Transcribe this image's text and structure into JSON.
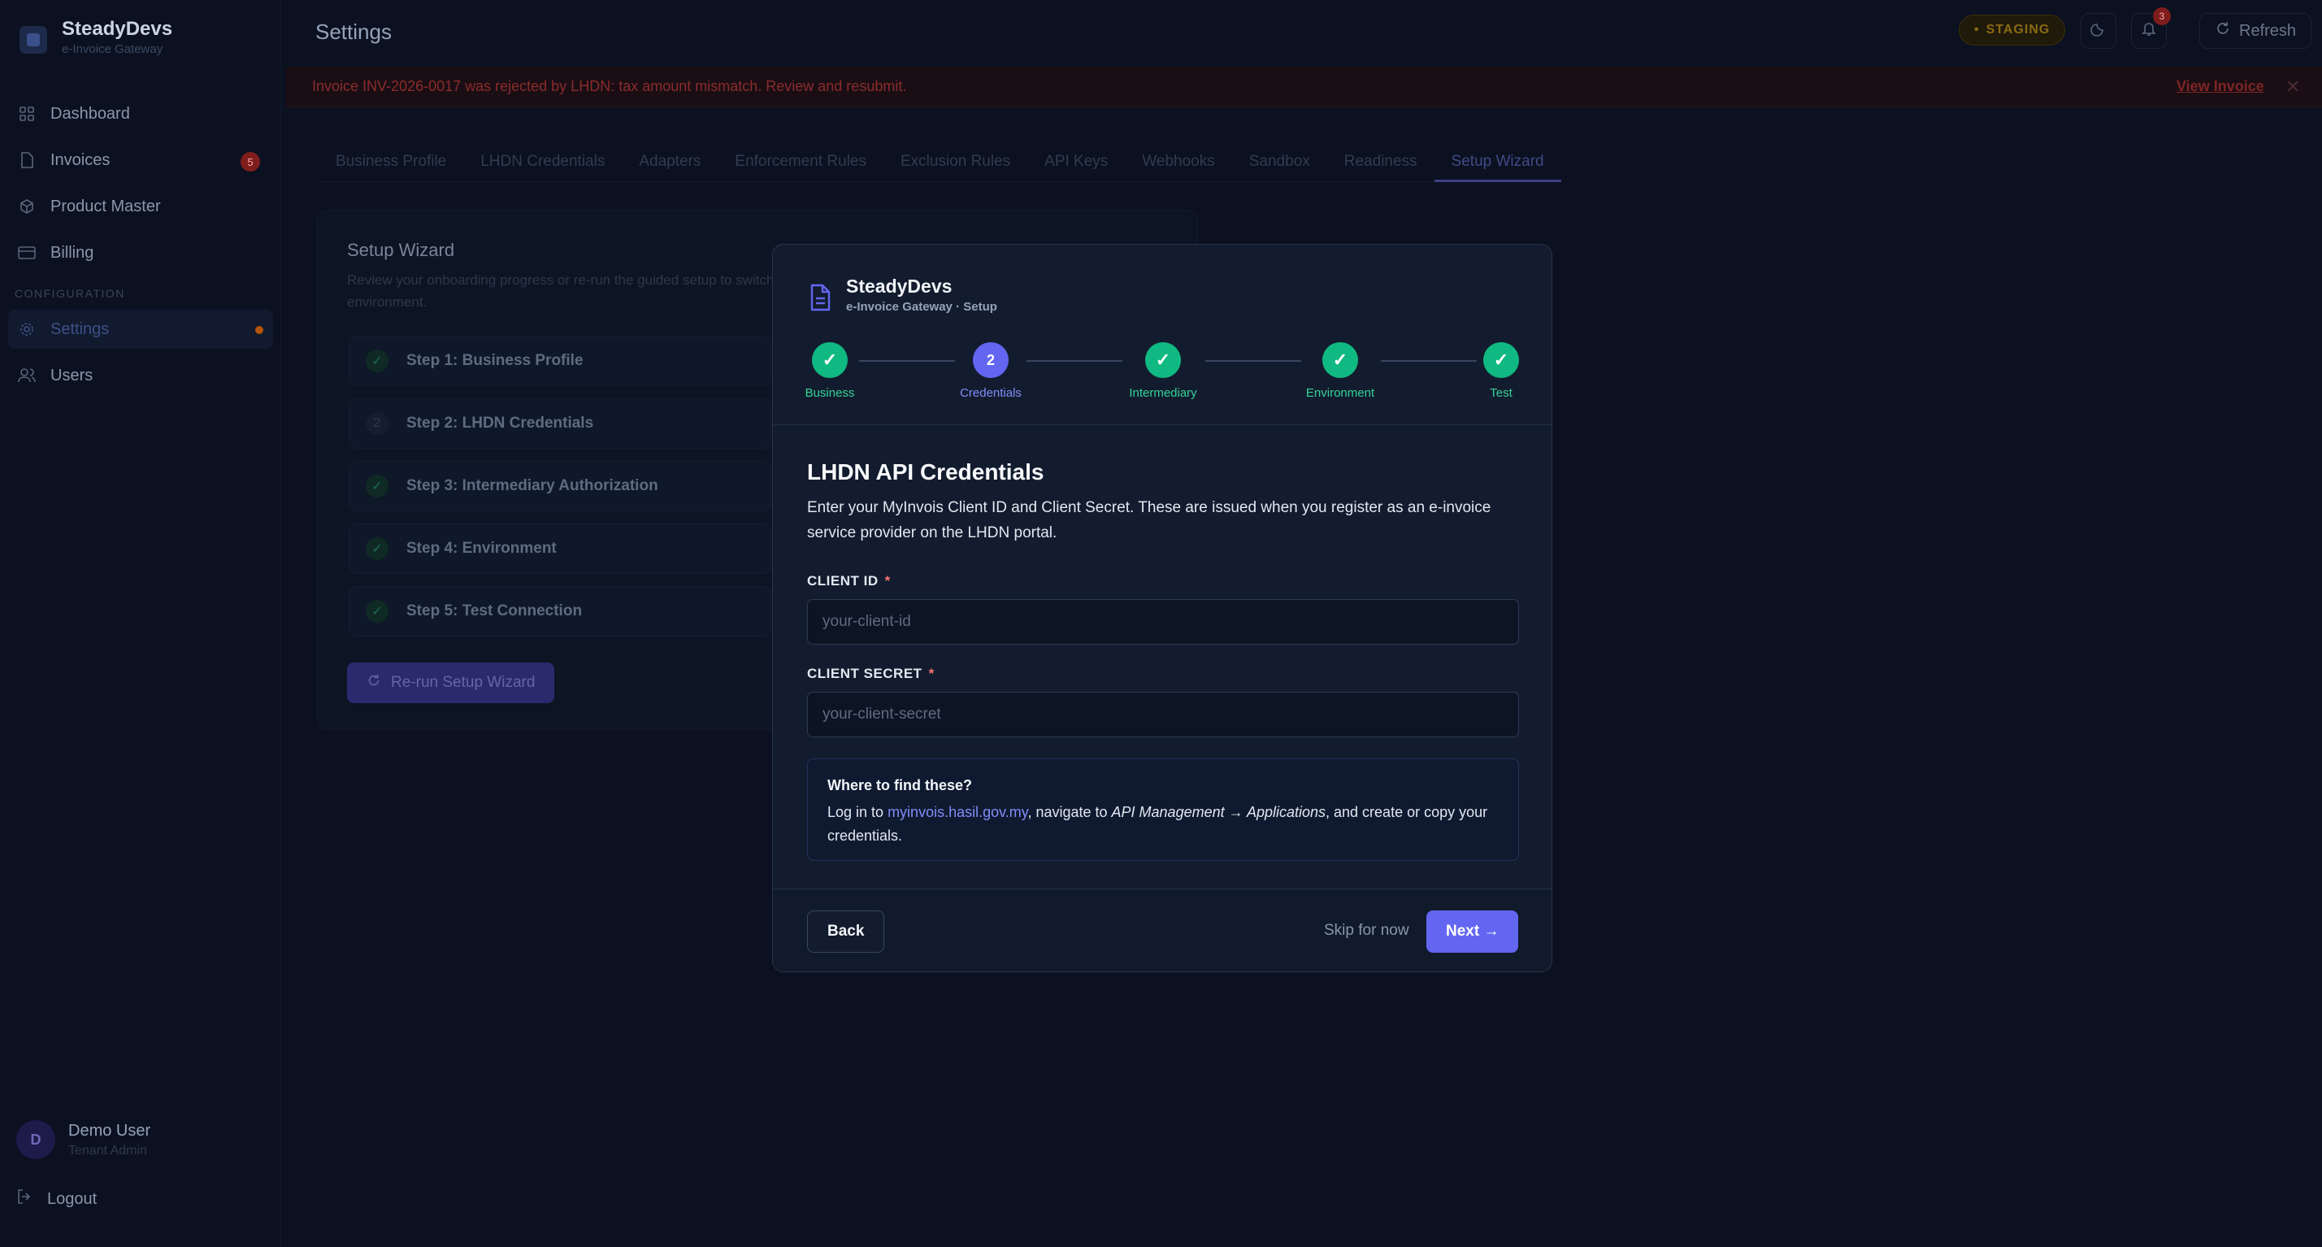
{
  "app": {
    "name": "SteadyDevs",
    "subtitle": "e-Invoice Gateway"
  },
  "sidebar": {
    "items": [
      {
        "label": "Dashboard",
        "icon": "grid-icon"
      },
      {
        "label": "Invoices",
        "icon": "file-icon",
        "badge": "5"
      },
      {
        "label": "Product Master",
        "icon": "package-icon"
      },
      {
        "label": "Billing",
        "icon": "credit-card-icon"
      }
    ],
    "section_label": "CONFIGURATION",
    "config_items": [
      {
        "label": "Settings",
        "icon": "gear-icon",
        "active": true
      },
      {
        "label": "Users",
        "icon": "users-icon"
      }
    ],
    "user": {
      "initial": "D",
      "name": "Demo User",
      "role": "Tenant Admin"
    },
    "logout_label": "Logout"
  },
  "header": {
    "title": "Settings",
    "env_badge": "STAGING",
    "notification_count": "3",
    "refresh_label": "Refresh"
  },
  "alert": {
    "message": "Invoice INV-2026-0017 was rejected by LHDN: tax amount mismatch. Review and resubmit.",
    "link_label": "View Invoice"
  },
  "tabs": [
    {
      "label": "Business Profile"
    },
    {
      "label": "LHDN Credentials"
    },
    {
      "label": "Adapters"
    },
    {
      "label": "Enforcement Rules"
    },
    {
      "label": "Exclusion Rules"
    },
    {
      "label": "API Keys"
    },
    {
      "label": "Webhooks"
    },
    {
      "label": "Sandbox"
    },
    {
      "label": "Readiness"
    },
    {
      "label": "Setup Wizard",
      "active": true
    }
  ],
  "setup_card": {
    "title": "Setup Wizard",
    "description": "Review your onboarding progress or re-run the guided setup to switch environment.",
    "steps": [
      {
        "label": "Step 1: Business Profile",
        "status": "done"
      },
      {
        "label": "Step 2: LHDN Credentials",
        "status": "pending",
        "num": "2"
      },
      {
        "label": "Step 3: Intermediary Authorization",
        "status": "done"
      },
      {
        "label": "Step 4: Environment",
        "status": "done"
      },
      {
        "label": "Step 5: Test Connection",
        "status": "done"
      }
    ],
    "rerun_label": "Re-run Setup Wizard"
  },
  "modal": {
    "brand_name": "SteadyDevs",
    "brand_sub": "e-Invoice Gateway · Setup",
    "stepper": [
      {
        "label": "Business",
        "status": "done",
        "mark": "✓"
      },
      {
        "label": "Credentials",
        "status": "current",
        "mark": "2"
      },
      {
        "label": "Intermediary",
        "status": "done",
        "mark": "✓"
      },
      {
        "label": "Environment",
        "status": "done",
        "mark": "✓"
      },
      {
        "label": "Test",
        "status": "done",
        "mark": "✓"
      }
    ],
    "title": "LHDN API Credentials",
    "description": "Enter your MyInvois Client ID and Client Secret. These are issued when you register as an e-invoice service provider on the LHDN portal.",
    "client_id": {
      "label": "CLIENT ID",
      "required": "*",
      "value": "",
      "placeholder": "your-client-id"
    },
    "client_secret": {
      "label": "CLIENT SECRET",
      "required": "*",
      "value": "",
      "placeholder": "your-client-secret"
    },
    "help": {
      "title": "Where to find these?",
      "text_before": "Log in to ",
      "link": "myinvois.hasil.gov.my",
      "text_middle": ", navigate to ",
      "path": "API Management → Applications",
      "text_after": ", and create or copy your credentials."
    },
    "back_label": "Back",
    "skip_label": "Skip for now",
    "next_label": "Next →"
  },
  "colors": {
    "accent": "#6366f1",
    "success": "#10b981",
    "danger": "#f87171",
    "background": "#0b1120",
    "modal_bg": "#131c2e"
  }
}
